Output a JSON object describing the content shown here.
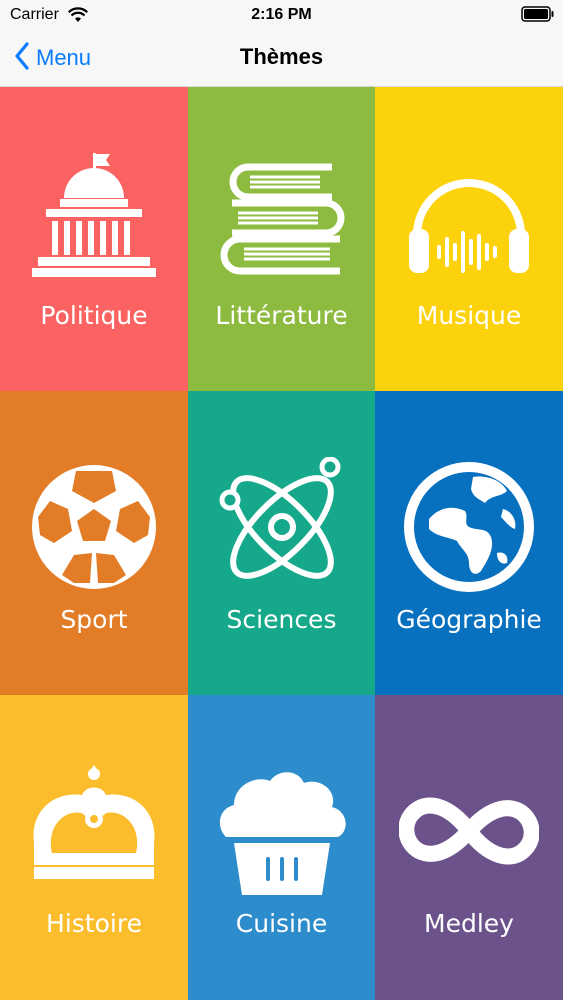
{
  "status_bar": {
    "carrier": "Carrier",
    "time": "2:16 PM",
    "icons": [
      "wifi-icon",
      "battery-icon"
    ]
  },
  "nav": {
    "back_label": "Menu",
    "title": "Thèmes",
    "icons": [
      "chevron-left-icon"
    ]
  },
  "themes": [
    {
      "label": "Politique",
      "icon": "capitol-icon",
      "color": "#fa6361"
    },
    {
      "label": "Littérature",
      "icon": "books-icon",
      "color": "#8cbb40"
    },
    {
      "label": "Musique",
      "icon": "headphones-icon",
      "color": "#fcd20d"
    },
    {
      "label": "Sport",
      "icon": "soccer-ball-icon",
      "color": "#e27c27"
    },
    {
      "label": "Sciences",
      "icon": "atom-icon",
      "color": "#16a88a"
    },
    {
      "label": "Géographie",
      "icon": "globe-icon",
      "color": "#0771c0"
    },
    {
      "label": "Histoire",
      "icon": "crown-icon",
      "color": "#fbbd2c"
    },
    {
      "label": "Cuisine",
      "icon": "cupcake-icon",
      "color": "#2d8ccb"
    },
    {
      "label": "Medley",
      "icon": "infinity-icon",
      "color": "#6c528a"
    }
  ]
}
